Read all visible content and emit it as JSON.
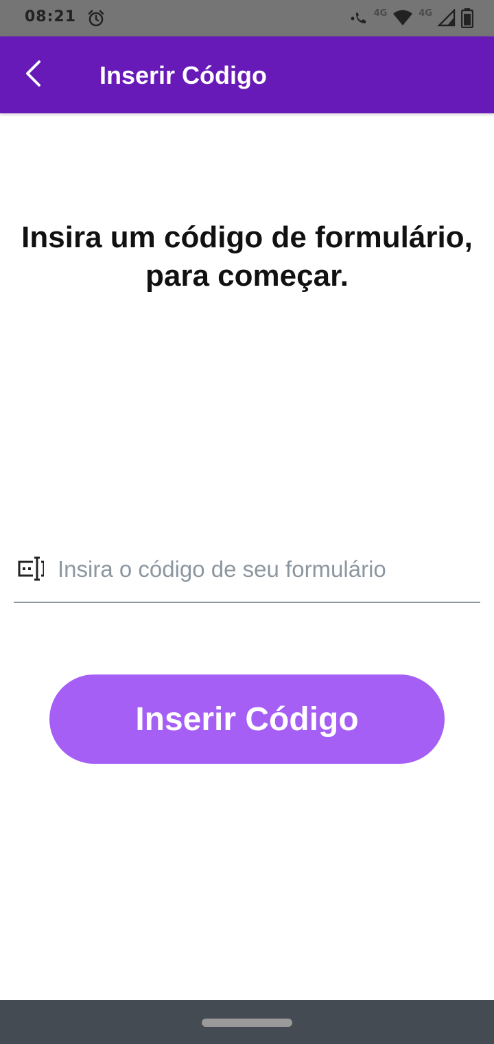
{
  "status_bar": {
    "time": "08:21",
    "network_label_1": "4G",
    "network_label_2": "4G",
    "icons": [
      "alarm-icon",
      "call-icon",
      "wifi-icon",
      "signal-icon",
      "battery-icon"
    ]
  },
  "app_bar": {
    "title": "Inserir Código",
    "back_icon": "chevron-left-icon",
    "background_color": "#671ab8"
  },
  "main": {
    "headline_line1": "Insira um código de formulário,",
    "headline_line2": "para começar.",
    "code_input": {
      "placeholder": "Insira o código de seu formulário",
      "value": "",
      "icon": "form-code-icon"
    },
    "submit_button": {
      "label": "Inserir Código",
      "color": "#a65ff5"
    }
  },
  "nav_bar": {
    "background_color": "#454b52"
  }
}
